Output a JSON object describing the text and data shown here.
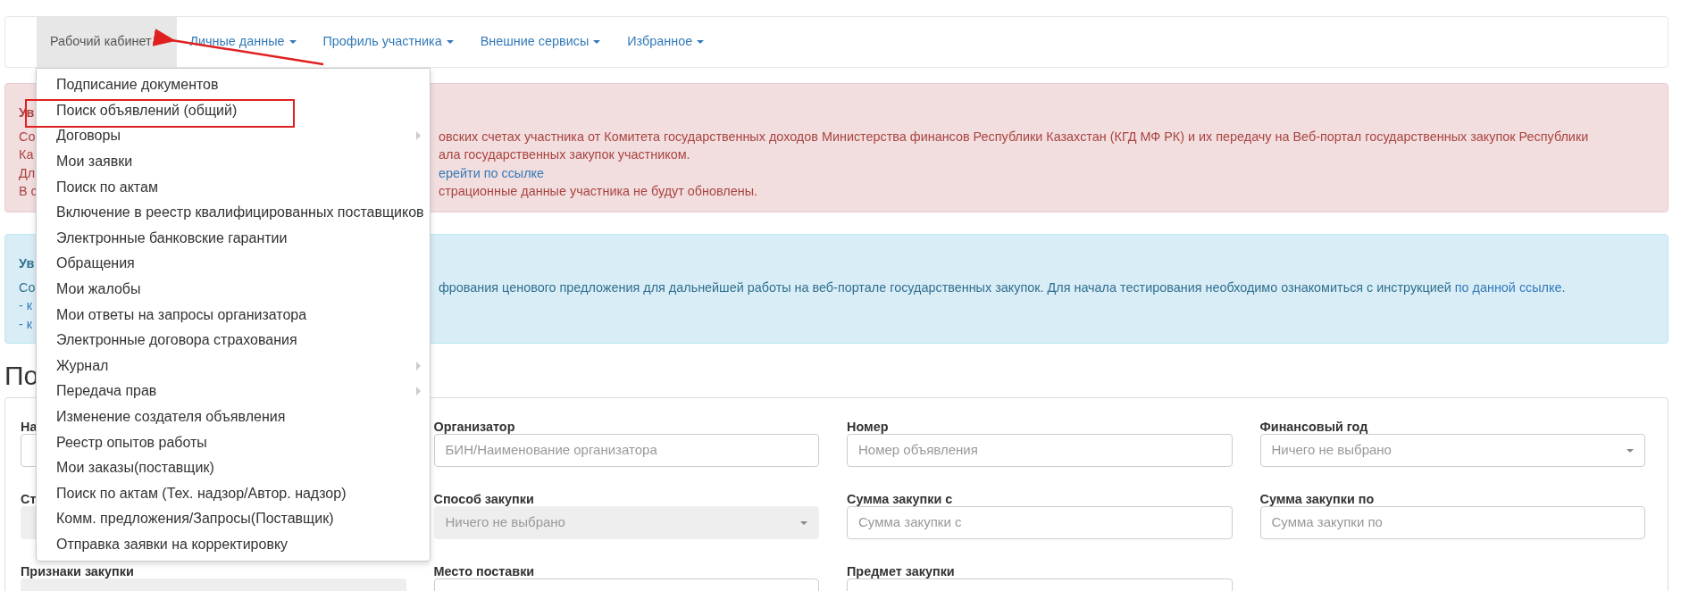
{
  "nav": {
    "items": [
      {
        "label": "Рабочий кабинет",
        "selected": true
      },
      {
        "label": "Личные данные",
        "selected": false
      },
      {
        "label": "Профиль участника",
        "selected": false
      },
      {
        "label": "Внешние сервисы",
        "selected": false
      },
      {
        "label": "Избранное",
        "selected": false
      }
    ]
  },
  "menu": {
    "items": [
      {
        "label": "Подписание документов",
        "submenu": false,
        "annotated": false
      },
      {
        "label": "Поиск объявлений (общий)",
        "submenu": false,
        "annotated": true
      },
      {
        "label": "Договоры",
        "submenu": true,
        "annotated": false
      },
      {
        "label": "Мои заявки",
        "submenu": false,
        "annotated": false
      },
      {
        "label": "Поиск по актам",
        "submenu": false,
        "annotated": false
      },
      {
        "label": "Включение в реестр квалифицированных поставщиков",
        "submenu": false,
        "annotated": false
      },
      {
        "label": "Электронные банковские гарантии",
        "submenu": false,
        "annotated": false
      },
      {
        "label": "Обращения",
        "submenu": false,
        "annotated": false
      },
      {
        "label": "Мои жалобы",
        "submenu": false,
        "annotated": false
      },
      {
        "label": "Мои ответы на запросы организатора",
        "submenu": false,
        "annotated": false
      },
      {
        "label": "Электронные договора страхования",
        "submenu": false,
        "annotated": false
      },
      {
        "label": "Журнал",
        "submenu": true,
        "annotated": false
      },
      {
        "label": "Передача прав",
        "submenu": true,
        "annotated": false
      },
      {
        "label": "Изменение создателя объявления",
        "submenu": false,
        "annotated": false
      },
      {
        "label": "Реестр опытов работы",
        "submenu": false,
        "annotated": false
      },
      {
        "label": "Мои заказы(поставщик)",
        "submenu": false,
        "annotated": false
      },
      {
        "label": "Поиск по актам (Тех. надзор/Автор. надзор)",
        "submenu": false,
        "annotated": false
      },
      {
        "label": "Комм. предложения/Запросы(Поставщик)",
        "submenu": false,
        "annotated": false
      },
      {
        "label": "Отправка заявки на корректировку",
        "submenu": false,
        "annotated": false
      }
    ]
  },
  "alerts": [
    {
      "kind": "danger",
      "title": "Ув",
      "lines": [
        {
          "left": "Со",
          "right": [
            {
              "kind": "text",
              "text": "овских счетах участника от Комитета государственных доходов Министерства финансов Республики Казахстан (КГД МФ РК) и их передачу на Веб-портал государственных закупок Республики"
            }
          ]
        },
        {
          "left": "Ка",
          "right": [
            {
              "kind": "text",
              "text": "ала государственных закупок участником."
            }
          ]
        },
        {
          "left": "Дл",
          "right": [
            {
              "kind": "link",
              "text": "ерейти по ссылке"
            }
          ]
        },
        {
          "left": "В с",
          "right": [
            {
              "kind": "text",
              "text": "страционные данные участника не будут обновлены."
            }
          ]
        }
      ]
    },
    {
      "kind": "info",
      "title": "Ув",
      "lines": [
        {
          "left": "Со",
          "right": [
            {
              "kind": "text",
              "text": "фрования ценового предложения для дальнейшей работы на веб-портале государственных закупок. Для начала тестирования необходимо ознакомиться с инструкцией "
            },
            {
              "kind": "link",
              "text": "по данной ссылке"
            },
            {
              "kind": "text",
              "text": "."
            }
          ]
        },
        {
          "left": "- к"
        },
        {
          "left": "- к"
        }
      ]
    }
  ],
  "heading": "По",
  "form": {
    "rows": [
      [
        {
          "label": "На",
          "kind": "input",
          "disabled": false
        },
        {
          "label": "Организатор",
          "kind": "input",
          "placeholder": "БИН/Наименование организатора",
          "disabled": false
        },
        {
          "label": "Номер",
          "kind": "input",
          "placeholder": "Номер объявления",
          "disabled": false
        },
        {
          "label": "Финансовый год",
          "kind": "select",
          "placeholder": "Ничего не выбрано",
          "disabled": false
        }
      ],
      [
        {
          "label": "Ст",
          "kind": "select",
          "disabled": true
        },
        {
          "label": "Способ закупки",
          "kind": "select",
          "placeholder": "Ничего не выбрано",
          "disabled": true
        },
        {
          "label": "Сумма закупки с",
          "kind": "input",
          "placeholder": "Сумма закупки с",
          "disabled": false
        },
        {
          "label": "Сумма закупки по",
          "kind": "input",
          "placeholder": "Сумма закупки по",
          "disabled": false
        }
      ],
      [
        {
          "label": "Признаки закупки",
          "kind": "select",
          "disabled": true
        },
        {
          "label": "Место поставки",
          "kind": "input",
          "disabled": false
        },
        {
          "label": "Предмет закупки",
          "kind": "input",
          "disabled": false
        }
      ]
    ]
  }
}
